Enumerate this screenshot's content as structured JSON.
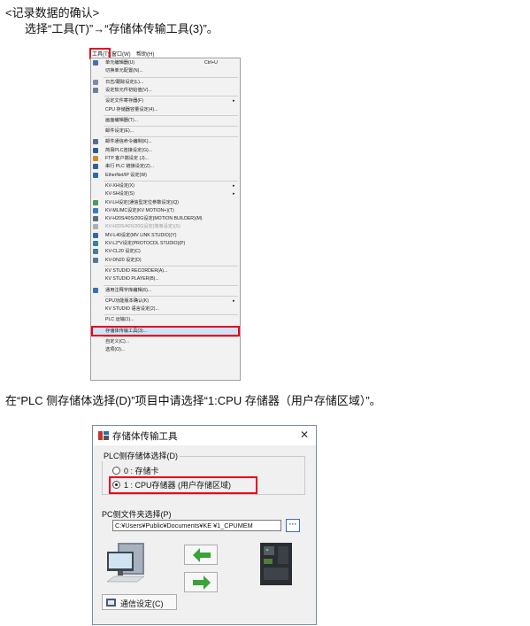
{
  "heading": "<记录数据的确认>",
  "instruction1": "选择“工具(T)”→“存储体传输工具(3)”。",
  "instruction2": "在“PLC 侧存储体选择(D)”项目中请选择“1:CPU 存储器（用户存储区域）”。",
  "menubar": {
    "tools": "工具(T)",
    "window": "窗口(W)",
    "help": "帮助(H)"
  },
  "menu_items": [
    {
      "label": "单元编辑器(U)",
      "shortcut": "Ctrl+U",
      "submenu": false,
      "disabled": false,
      "icon": "unit-editor-icon",
      "icon_color": "#4a6fa5"
    },
    {
      "label": "切换单元配置(N)...",
      "shortcut": "",
      "submenu": false,
      "disabled": false,
      "icon": "",
      "icon_color": ""
    },
    {
      "label": "日志/跟踪设定(L)...",
      "shortcut": "",
      "submenu": false,
      "disabled": false,
      "icon": "log-trace-icon",
      "icon_color": "#7d8fa8"
    },
    {
      "label": "设定软元件初始值(V)...",
      "shortcut": "",
      "submenu": false,
      "disabled": false,
      "icon": "device-init-icon",
      "icon_color": "#6e7f99"
    },
    {
      "label": "设定文件寄存器(F)",
      "shortcut": "",
      "submenu": true,
      "disabled": false,
      "icon": "",
      "icon_color": ""
    },
    {
      "label": "CPU 存储器容量设定(4)...",
      "shortcut": "",
      "submenu": false,
      "disabled": false,
      "icon": "",
      "icon_color": ""
    },
    {
      "label": "画面编辑器(T)...",
      "shortcut": "",
      "submenu": false,
      "disabled": false,
      "icon": "",
      "icon_color": ""
    },
    {
      "label": "邮件设定(E)...",
      "shortcut": "",
      "submenu": false,
      "disabled": false,
      "icon": "",
      "icon_color": ""
    },
    {
      "label": "邮件通信命令编制(K)...",
      "shortcut": "",
      "submenu": false,
      "disabled": false,
      "icon": "mail-command-icon",
      "icon_color": "#5a6c86"
    },
    {
      "label": "简易PLC连接设定(G)...",
      "shortcut": "",
      "submenu": false,
      "disabled": false,
      "icon": "plc-link-icon",
      "icon_color": "#2f5a8f"
    },
    {
      "label": "FTP 客户端设定 (J)...",
      "shortcut": "",
      "submenu": false,
      "disabled": false,
      "icon": "ftp-client-icon",
      "icon_color": "#d28a2c"
    },
    {
      "label": "串行 PLC 链接设定(Z)...",
      "shortcut": "",
      "submenu": false,
      "disabled": false,
      "icon": "serial-link-icon",
      "icon_color": "#355f8f"
    },
    {
      "label": "EtherNet/IP 设定(W)",
      "shortcut": "",
      "submenu": false,
      "disabled": false,
      "icon": "ethernet-ip-icon",
      "icon_color": "#2d6aa8"
    },
    {
      "label": "KV-XH设定(X)",
      "shortcut": "",
      "submenu": true,
      "disabled": false,
      "icon": "",
      "icon_color": ""
    },
    {
      "label": "KV-SH设定(S)",
      "shortcut": "",
      "submenu": true,
      "disabled": false,
      "icon": "",
      "icon_color": ""
    },
    {
      "label": "KV-LH设定(通信型定位参数设定)(Q)",
      "shortcut": "",
      "submenu": false,
      "disabled": false,
      "icon": "kv-lh-icon",
      "icon_color": "#4c9a55"
    },
    {
      "label": "KV-ML/MC设定(KV MOTION+)(T)",
      "shortcut": "",
      "submenu": false,
      "disabled": false,
      "icon": "kv-motion-icon",
      "icon_color": "#3b7bbf"
    },
    {
      "label": "KV-H20S/40S/20G设定(MOTION BUILDER)(M)",
      "shortcut": "",
      "submenu": false,
      "disabled": false,
      "icon": "motion-builder-icon",
      "icon_color": "#5c6b7d"
    },
    {
      "label": "KV-H20S/40S/20G设定(简单设定)(S)",
      "shortcut": "",
      "submenu": false,
      "disabled": true,
      "icon": "simple-setting-icon",
      "icon_color": "#b0b0b0"
    },
    {
      "label": "MV-L40设定(MV LINK STUDIO)(Y)",
      "shortcut": "",
      "submenu": false,
      "disabled": false,
      "icon": "mv-link-icon",
      "icon_color": "#3468a5"
    },
    {
      "label": "KV-L2*V设定(PROTOCOL STUDIO)(P)",
      "shortcut": "",
      "submenu": false,
      "disabled": false,
      "icon": "protocol-studio-icon",
      "icon_color": "#3b7fa0"
    },
    {
      "label": "KV-CL20 设定(C)",
      "shortcut": "",
      "submenu": false,
      "disabled": false,
      "icon": "kv-cl20-icon",
      "icon_color": "#4d7a9c"
    },
    {
      "label": "KV-DN20 设定(D)",
      "shortcut": "",
      "submenu": false,
      "disabled": false,
      "icon": "kv-dn20-icon",
      "icon_color": "#4d7a9c"
    },
    {
      "label": "KV STUDIO RECORDER(A)...",
      "shortcut": "",
      "submenu": false,
      "disabled": false,
      "icon": "",
      "icon_color": ""
    },
    {
      "label": "KV STUDIO PLAYER(B)...",
      "shortcut": "",
      "submenu": false,
      "disabled": false,
      "icon": "",
      "icon_color": ""
    },
    {
      "label": "通用注释字库编辑(6)...",
      "shortcut": "",
      "submenu": false,
      "disabled": false,
      "icon": "comment-library-icon",
      "icon_color": "#3c70b0"
    },
    {
      "label": "CPU功能版本确认(K)",
      "shortcut": "",
      "submenu": true,
      "disabled": false,
      "icon": "",
      "icon_color": ""
    },
    {
      "label": "KV STUDIO 语言设定(2)...",
      "shortcut": "",
      "submenu": false,
      "disabled": false,
      "icon": "",
      "icon_color": ""
    },
    {
      "label": "PLC 运输(1)...",
      "shortcut": "",
      "submenu": false,
      "disabled": false,
      "icon": "",
      "icon_color": ""
    },
    {
      "label": "存储体传输工具(3)...",
      "shortcut": "",
      "submenu": false,
      "disabled": false,
      "icon": "",
      "icon_color": "",
      "highlighted": true
    },
    {
      "label": "自定义(C)...",
      "shortcut": "",
      "submenu": false,
      "disabled": false,
      "icon": "",
      "icon_color": ""
    },
    {
      "label": "选项(O)...",
      "shortcut": "",
      "submenu": false,
      "disabled": false,
      "icon": "",
      "icon_color": ""
    }
  ],
  "dialog": {
    "title": "存储体传输工具",
    "close_symbol": "✕",
    "plc_group_label": "PLC侧存储体选择(D)",
    "option0": "0 : 存储卡",
    "option1": "1 : CPU存储器 (用户存储区域)",
    "selected_option": 1,
    "pc_folder_label": "PC侧文件夹选择(P)",
    "path_value": "C:¥Users¥Public¥Documents¥KE  ¥1_CPUMEM",
    "browse_label": "···",
    "comm_button": "通信设定(C)"
  },
  "colors": {
    "highlight_box": "#e8001c",
    "arrow_green": "#3aa33a",
    "menu_highlight": "#cde3f7"
  }
}
